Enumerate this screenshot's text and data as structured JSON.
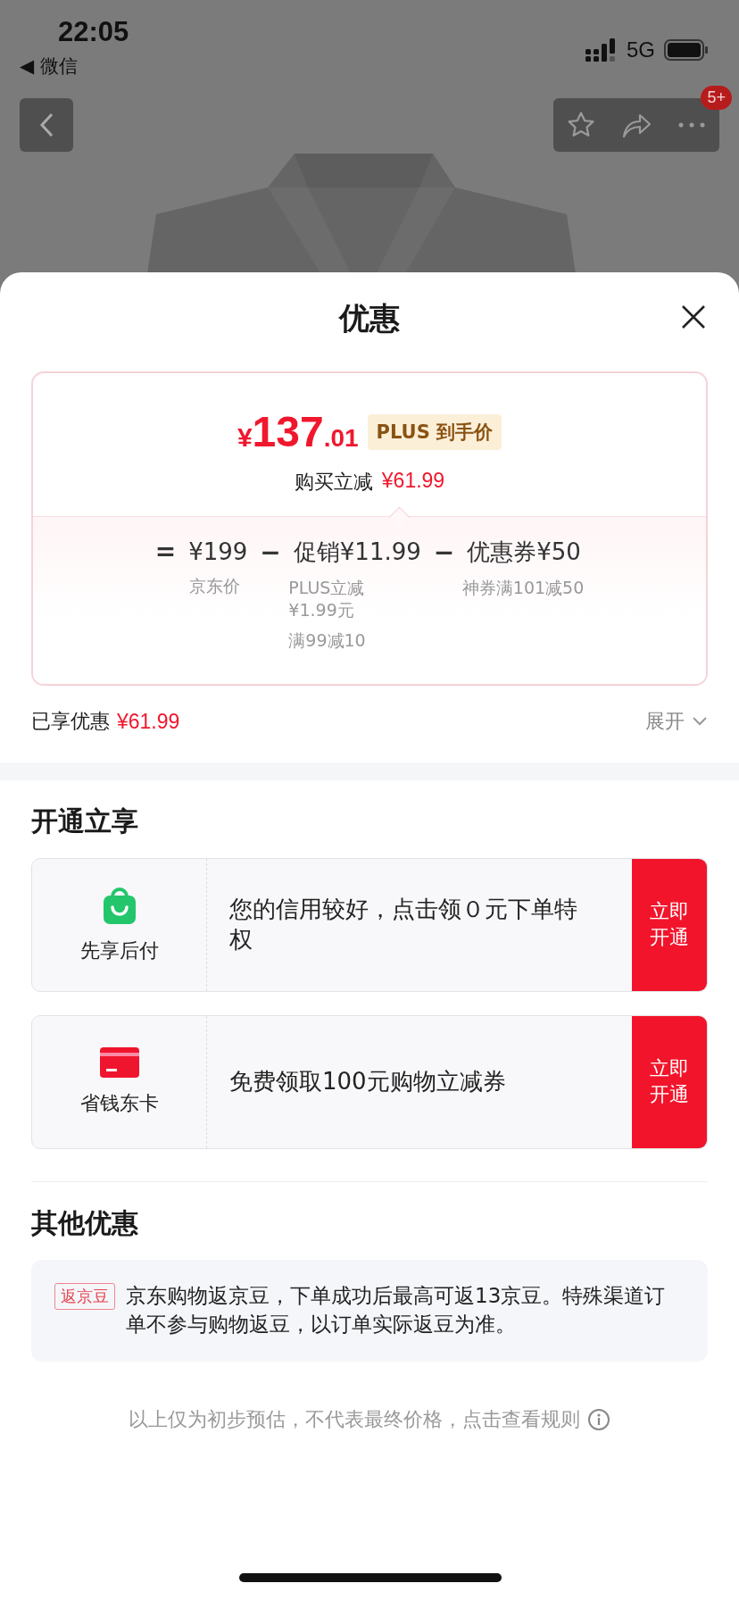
{
  "status_bar": {
    "time": "22:05",
    "back_app": "◀ 微信",
    "network": "5G"
  },
  "top_bar": {
    "cart_badge": "5+"
  },
  "sheet": {
    "title": "优惠",
    "price_card": {
      "currency": "¥",
      "price_integer": "137",
      "price_decimal": ".01",
      "price_tag": "PLUS 到手价",
      "discount_label": "购买立减",
      "discount_value": "¥61.99",
      "breakdown": [
        {
          "operator": "=",
          "amount": "¥199",
          "notes": [
            "京东价"
          ]
        },
        {
          "operator": "−",
          "amount": "促销¥11.99",
          "notes": [
            "PLUS立减¥1.99元",
            "满99减10"
          ]
        },
        {
          "operator": "−",
          "amount": "优惠券¥50",
          "notes": [
            "神券满101减50"
          ]
        }
      ]
    },
    "savings": {
      "label": "已享优惠",
      "value": "¥61.99",
      "toggle": "展开",
      "expanded": false
    },
    "sections": [
      {
        "title": "开通立享",
        "kind": "offers",
        "items": [
          {
            "kind": "bag",
            "name": "先享后付",
            "text": "您的信用较好，点击领０元下单特权",
            "action": "立即开通"
          },
          {
            "kind": "card",
            "name": "省钱东卡",
            "text": "免费领取100元购物立减券",
            "action": "立即开通"
          }
        ]
      },
      {
        "title": "其他优惠",
        "kind": "notes",
        "items": [
          {
            "tag": "返京豆",
            "text": "京东购物返京豆，下单成功后最高可返13京豆。特殊渠道订单不参与购物返豆，以订单实际返豆为准。"
          }
        ]
      }
    ],
    "footer_note": "以上仅为初步预估，不代表最终价格，点击查看规则"
  }
}
